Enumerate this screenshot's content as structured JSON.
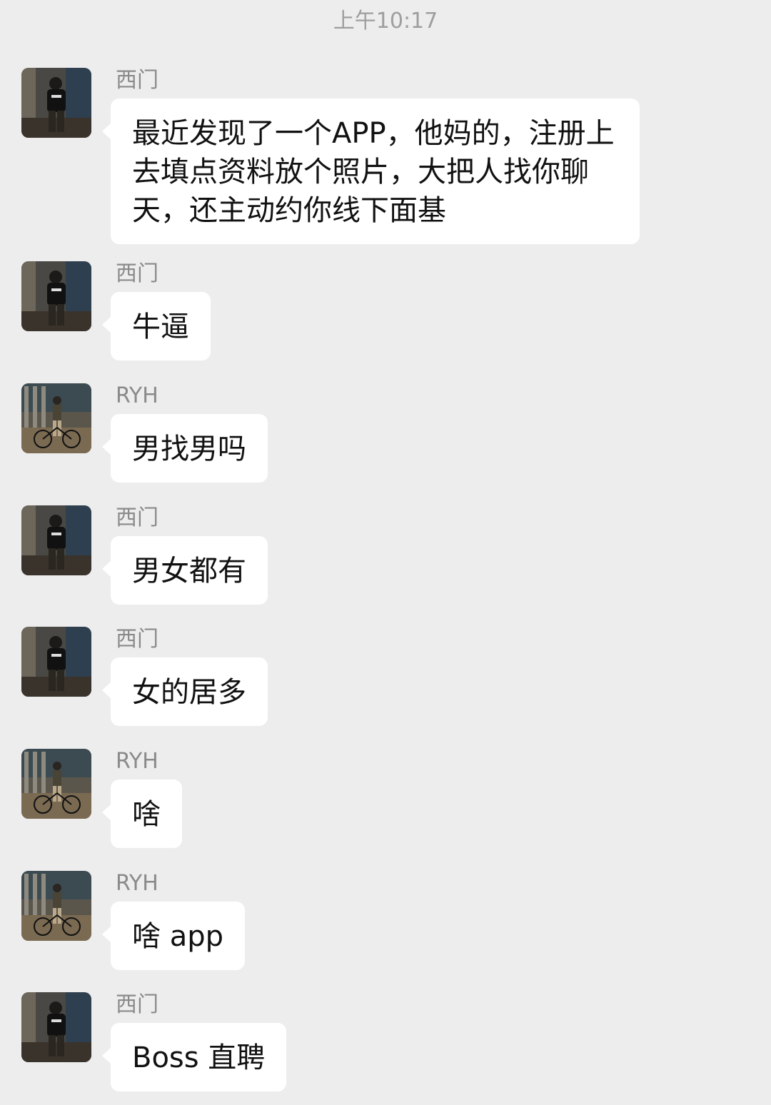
{
  "timestamp": "上午10:17",
  "colors": {
    "background": "#ededed",
    "bubble": "#ffffff",
    "sender": "#8a8a8a",
    "timestamp": "#9e9e9e"
  },
  "messages": [
    {
      "sender": "西门",
      "text": "最近发现了一个APP，他妈的，注册上去填点资料放个照片，大把人找你聊天，还主动约你线下面基",
      "avatar": "ximen-avatar"
    },
    {
      "sender": "西门",
      "text": "牛逼",
      "avatar": "ximen-avatar"
    },
    {
      "sender": "RYH",
      "text": "男找男吗",
      "avatar": "ryh-avatar"
    },
    {
      "sender": "西门",
      "text": "男女都有",
      "avatar": "ximen-avatar"
    },
    {
      "sender": "西门",
      "text": "女的居多",
      "avatar": "ximen-avatar"
    },
    {
      "sender": "RYH",
      "text": "啥",
      "avatar": "ryh-avatar"
    },
    {
      "sender": "RYH",
      "text": "啥 app",
      "avatar": "ryh-avatar"
    },
    {
      "sender": "西门",
      "text": "Boss 直聘",
      "avatar": "ximen-avatar"
    }
  ]
}
